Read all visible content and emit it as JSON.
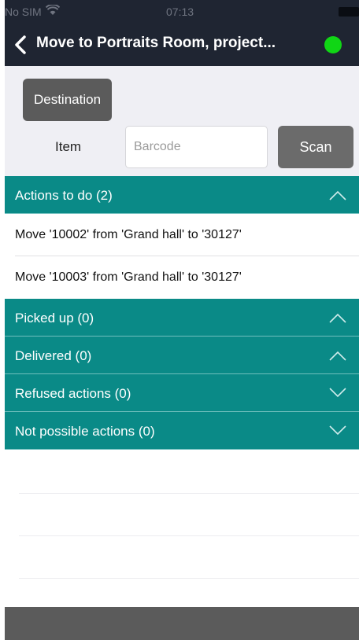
{
  "status_bar": {
    "carrier": "No SIM",
    "time": "07:13"
  },
  "nav": {
    "title": "Move to Portraits Room, project...",
    "status_color": "#10d615"
  },
  "form": {
    "destination_label": "Destination",
    "item_label": "Item",
    "barcode_placeholder": "Barcode",
    "barcode_value": "",
    "scan_label": "Scan"
  },
  "sections": {
    "actions_to_do": {
      "title": "Actions to do (2)",
      "expanded": true,
      "items": [
        "Move '10002' from 'Grand hall' to '30127'",
        "Move '10003' from 'Grand hall' to '30127'"
      ]
    },
    "picked_up": {
      "title": "Picked up (0)",
      "expanded": true
    },
    "delivered": {
      "title": "Delivered (0)",
      "expanded": true
    },
    "refused": {
      "title": "Refused actions (0)",
      "expanded": false
    },
    "not_possible": {
      "title": "Not possible actions (0)",
      "expanded": false
    }
  },
  "colors": {
    "header": "#1f2532",
    "section": "#0a8a87",
    "button": "#5b5b5b"
  },
  "icons": [
    "wifi-icon",
    "battery-icon",
    "back-chevron-icon",
    "chevron-up-icon",
    "chevron-down-icon"
  ]
}
